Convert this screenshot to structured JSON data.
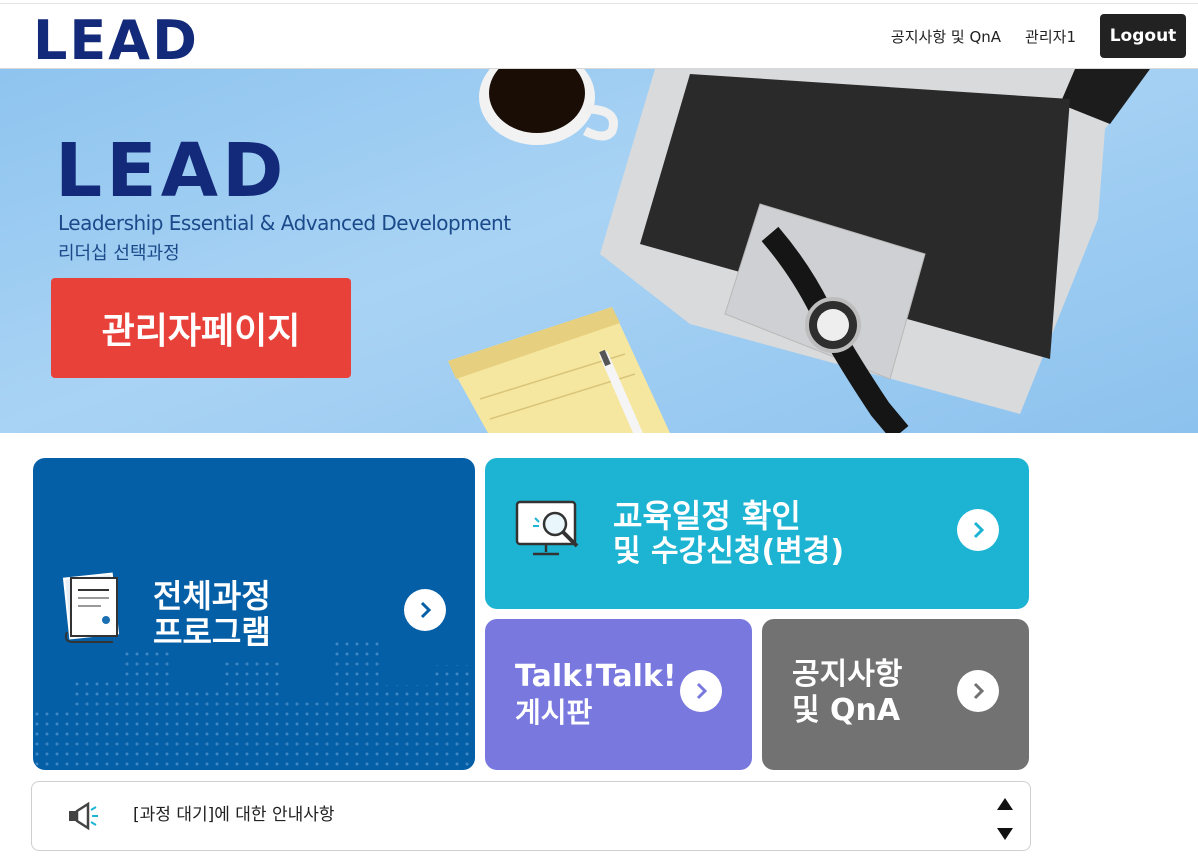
{
  "header": {
    "logo": "LEAD",
    "nav": {
      "notice_qna": "공지사항 및 QnA",
      "admin_user": "관리자1",
      "logout": "Logout"
    }
  },
  "hero": {
    "logo": "LEAD",
    "subtitle": "Leadership Essential & Advanced Development",
    "subtitle_kr": "리더십 선택과정",
    "admin_button": "관리자페이지"
  },
  "cards": {
    "program": {
      "line1": "전체과정",
      "line2": "프로그램"
    },
    "schedule": {
      "line1": "교육일정 확인",
      "line2": "및 수강신청(변경)"
    },
    "talk": {
      "line1": "Talk!Talk!",
      "line2": "게시판"
    },
    "notice": {
      "line1": "공지사항",
      "line2": "및 QnA"
    }
  },
  "notice_bar": {
    "text": "[과정 대기]에 대한 안내사항"
  },
  "colors": {
    "brand_navy": "#13297a",
    "admin_red": "#e8413a",
    "program_blue": "#045fa6",
    "schedule_cyan": "#1db4d3",
    "talk_purple": "#7878df",
    "notice_gray": "#727272"
  }
}
